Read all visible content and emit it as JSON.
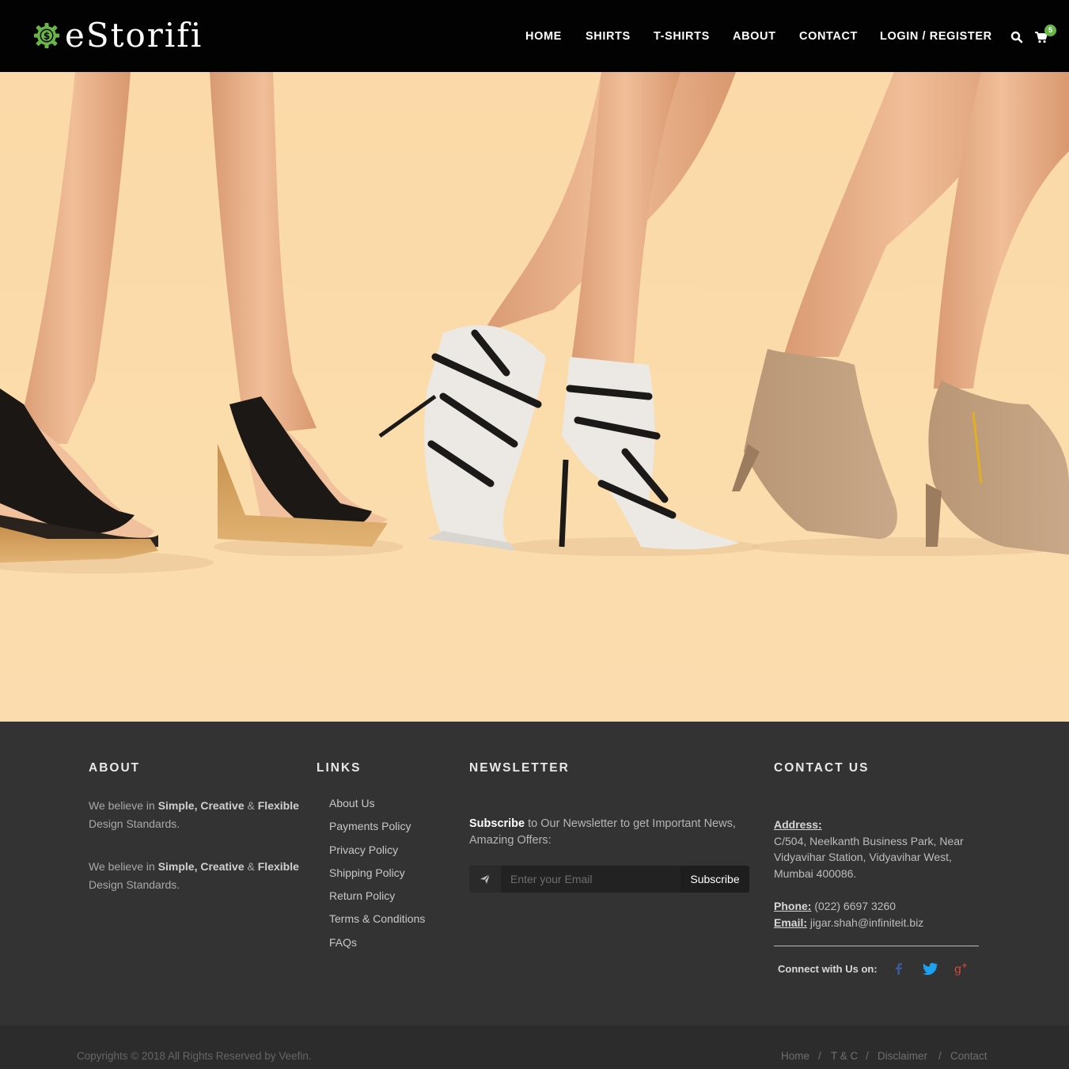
{
  "header": {
    "logo_text": "eStorifi",
    "nav": [
      "HOME",
      "SHIRTS",
      "T-SHIRTS",
      "ABOUT",
      "CONTACT",
      "LOGIN / REGISTER"
    ],
    "cart_count": "5",
    "icons": {
      "search": "search-icon",
      "cart": "cart-icon",
      "logo": "dollar-gear-icon"
    }
  },
  "hero": {
    "image": "women legs wearing wedge sandals, strappy white heels and tan ankle boots on peach background"
  },
  "footer": {
    "about": {
      "title": "ABOUT",
      "p1_pre": "We believe in ",
      "p1_b1": "Simple, Creative",
      "p1_amp": " & ",
      "p1_b2": "Flexible",
      "p1_post": " Design Standards.",
      "p2_pre": "We believe in ",
      "p2_b1": "Simple, Creative",
      "p2_amp": " & ",
      "p2_b2": "Flexible",
      "p2_post": " Design Standards."
    },
    "links": {
      "title": "LINKS",
      "items": [
        "About Us",
        "Payments Policy",
        "Privacy Policy",
        "Shipping Policy",
        "Return Policy",
        "Terms & Conditions",
        "FAQs"
      ]
    },
    "newsletter": {
      "title": "NEWSLETTER",
      "text_b": "Subscribe",
      "text": " to Our Newsletter to get Important News, Amazing Offers:",
      "placeholder": "Enter your Email",
      "button": "Subscribe"
    },
    "contact": {
      "title": "CONTACT US",
      "address_label": "Address:",
      "address": "C/504, Neelkanth Business Park, Near Vidyavihar Station, Vidyavihar West, Mumbai 400086.",
      "phone_label": "Phone:",
      "phone": " (022) 6697 3260",
      "email_label": "Email:",
      "email": " jigar.shah@infiniteit.biz",
      "connect": "Connect with Us on:",
      "social": [
        "facebook-icon",
        "twitter-icon",
        "google-plus-icon"
      ]
    }
  },
  "bottom": {
    "copyright": "Copyrights © 2018 All Rights Reserved by Veefin.",
    "links": [
      "Home",
      "T & C",
      "Disclaimer",
      "Contact"
    ],
    "separator": "/"
  },
  "colors": {
    "accent": "#6ab547",
    "header_bg": "#020202",
    "footer_bg": "#333333",
    "hero_bg": "#fbdcab"
  }
}
